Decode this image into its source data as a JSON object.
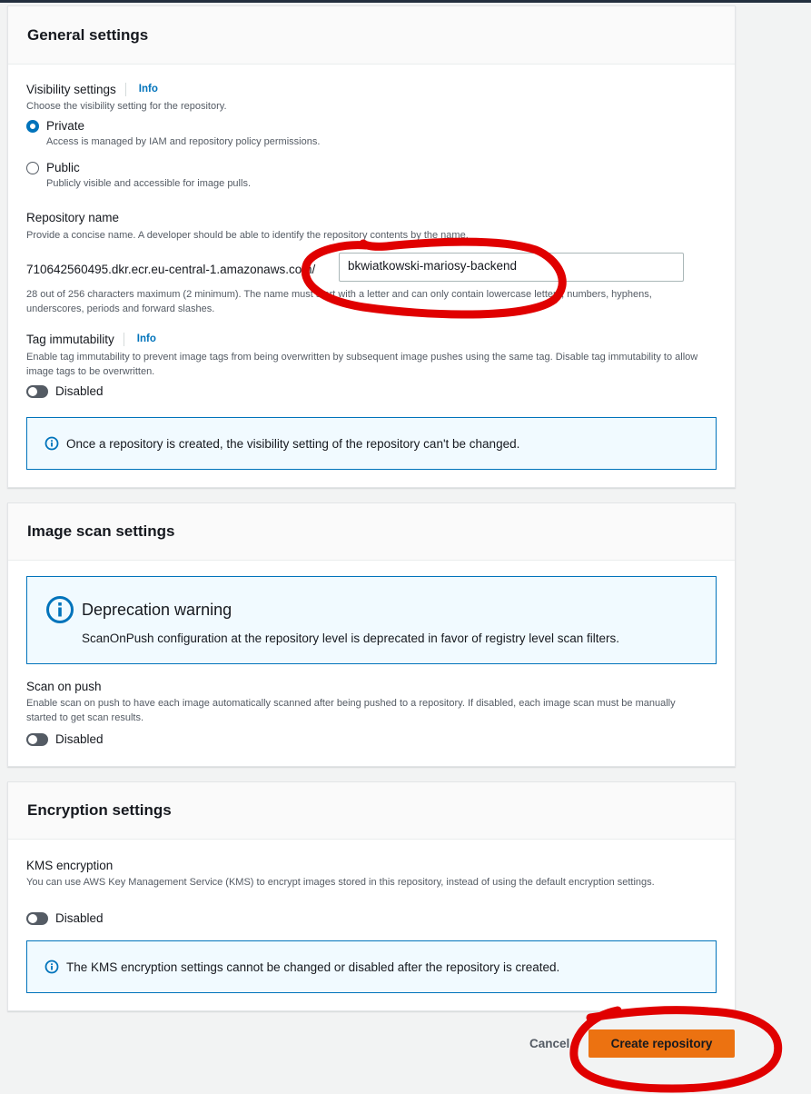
{
  "general": {
    "title": "General settings",
    "visibility": {
      "label": "Visibility settings",
      "info": "Info",
      "description": "Choose the visibility setting for the repository.",
      "options": [
        {
          "label": "Private",
          "description": "Access is managed by IAM and repository policy permissions.",
          "selected": true
        },
        {
          "label": "Public",
          "description": "Publicly visible and accessible for image pulls.",
          "selected": false
        }
      ]
    },
    "repo_name": {
      "label": "Repository name",
      "description": "Provide a concise name. A developer should be able to identify the repository contents by the name.",
      "prefix": "710642560495.dkr.ecr.eu-central-1.amazonaws.com/",
      "value": "bkwiatkowski-mariosy-backend",
      "constraint": "28 out of 256 characters maximum (2 minimum). The name must start with a letter and can only contain lowercase letters, numbers, hyphens, underscores, periods and forward slashes."
    },
    "tag_immutability": {
      "label": "Tag immutability",
      "info": "Info",
      "description": "Enable tag immutability to prevent image tags from being overwritten by subsequent image pushes using the same tag. Disable tag immutability to allow image tags to be overwritten.",
      "toggle_label": "Disabled"
    },
    "alert": "Once a repository is created, the visibility setting of the repository can't be changed."
  },
  "image_scan": {
    "title": "Image scan settings",
    "warning_title": "Deprecation warning",
    "warning_text": "ScanOnPush configuration at the repository level is deprecated in favor of registry level scan filters.",
    "scan_on_push": {
      "label": "Scan on push",
      "description": "Enable scan on push to have each image automatically scanned after being pushed to a repository. If disabled, each image scan must be manually started to get scan results.",
      "toggle_label": "Disabled"
    }
  },
  "encryption": {
    "title": "Encryption settings",
    "kms": {
      "label": "KMS encryption",
      "description": "You can use AWS Key Management Service (KMS) to encrypt images stored in this repository, instead of using the default encryption settings.",
      "toggle_label": "Disabled"
    },
    "alert": "The KMS encryption settings cannot be changed or disabled after the repository is created."
  },
  "actions": {
    "cancel": "Cancel",
    "create": "Create repository"
  },
  "colors": {
    "primary_button": "#ec7211",
    "link": "#0073bb",
    "annotation": "#e00000"
  }
}
